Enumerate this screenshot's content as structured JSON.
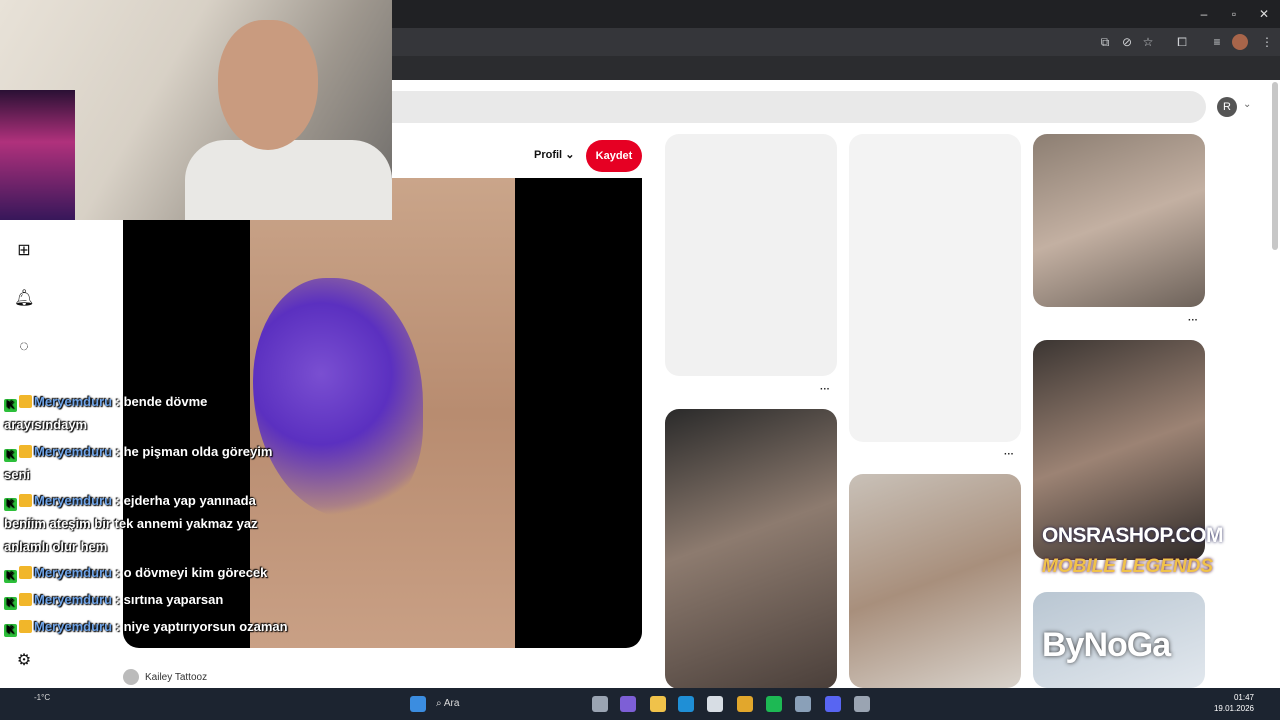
{
  "page": {
    "profile_dropdown_label": "Profil",
    "save_button_label": "Kaydet",
    "avatar_initial": "R",
    "pin_author": "Kailey Tattooz"
  },
  "chat": [
    {
      "user": "Meryemduru",
      "message": ": bende dövme",
      "continued": "arayısındaym"
    },
    {
      "user": "Meryemduru",
      "message": ": he pişman olda göreyim",
      "continued": "seni"
    },
    {
      "user": "Meryemduru",
      "message": ": ejderha yap yanınada",
      "continued": "beniim ateşim bir tek annemi yakmaz yaz",
      "continued2": "anlamlı olur hem"
    },
    {
      "user": "Meryemduru",
      "message": ": o dövmeyi kim görecek"
    },
    {
      "user": "Meryemduru",
      "message": ": sırtına yaparsan"
    },
    {
      "user": "Meryemduru",
      "message": ": niye yaptırıyorsun ozaman"
    }
  ],
  "overlay": {
    "brand_line1": "ONSRASHOP.COM",
    "brand_line2": "MOBILE LEGENDS",
    "brand_line3": "ByNoGa"
  },
  "taskbar": {
    "search_label": "Ara",
    "time": "01:47",
    "date": "19.01.2026",
    "weather": "-1°C"
  },
  "colors": {
    "save_button": "#e60023",
    "chat_username": "#6fa4e8",
    "taskbar_bg": "#1c2430"
  },
  "icons": [
    "create-icon",
    "notifications-icon",
    "messages-icon",
    "settings-icon",
    "cast-icon",
    "eye-off-icon",
    "star-icon",
    "extensions-icon",
    "menu-icon"
  ]
}
